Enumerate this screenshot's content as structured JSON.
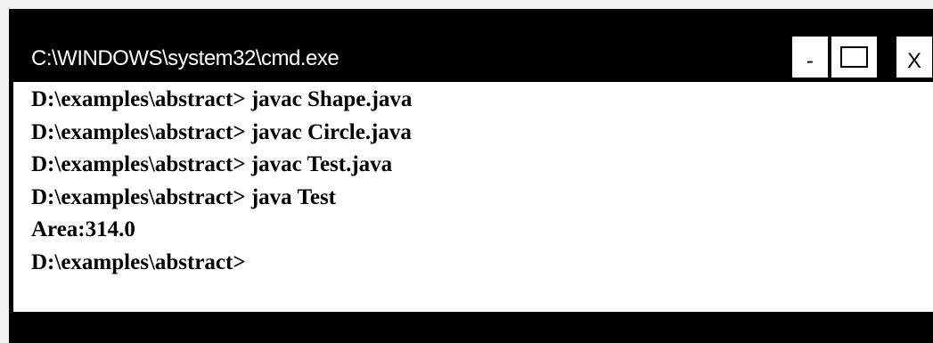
{
  "window": {
    "title": "C:\\WINDOWS\\system32\\cmd.exe",
    "buttons": {
      "minimize": "-",
      "close": "X"
    }
  },
  "console": {
    "lines": [
      "D:\\examples\\abstract> javac Shape.java",
      "D:\\examples\\abstract> javac Circle.java",
      "D:\\examples\\abstract> javac Test.java",
      "D:\\examples\\abstract> java Test",
      "Area:314.0",
      "D:\\examples\\abstract>"
    ]
  },
  "colors": {
    "titlebar": "#000000",
    "title_text": "#ffffff",
    "console_background": "#ffffff",
    "console_text": "#000000",
    "page_background": "#f2f2f2"
  }
}
